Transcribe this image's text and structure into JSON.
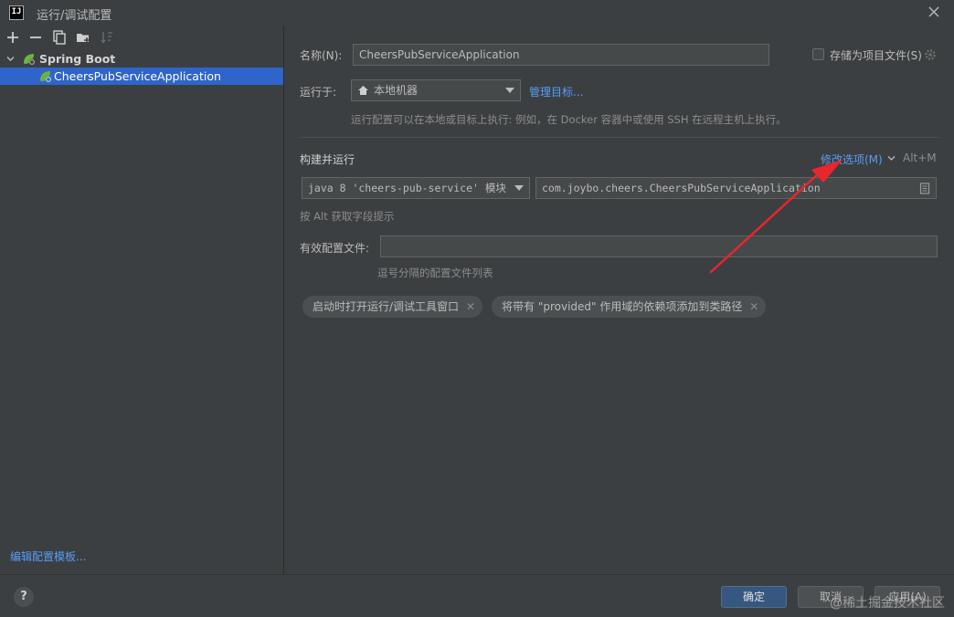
{
  "window": {
    "app_logo": "IJ",
    "title": "运行/调试配置"
  },
  "tree": {
    "group_label": "Spring Boot",
    "selected_item": "CheersPubServiceApplication"
  },
  "left_footer": {
    "edit_templates_link": "编辑配置模板..."
  },
  "form": {
    "name_label": "名称(N):",
    "name_value": "CheersPubServiceApplication",
    "store_as_project_file": "存储为项目文件(S)",
    "run_on_label": "运行于:",
    "run_on_value": "本地机器",
    "manage_targets_link": "管理目标...",
    "run_on_hint": "运行配置可以在本地或目标上执行: 例如，在 Docker 容器中或使用 SSH 在远程主机上执行。",
    "build_run_title": "构建并运行",
    "modify_options_link": "修改选项(M)",
    "modify_options_shortcut": "Alt+M",
    "jdk_value": "java 8 'cheers-pub-service' 模块",
    "main_class_value": "com.joybo.cheers.CheersPubServiceApplication",
    "alt_hint": "按 Alt 获取字段提示",
    "active_profiles_label": "有效配置文件:",
    "active_profiles_value": "",
    "active_profiles_hint": "逗号分隔的配置文件列表",
    "chips": [
      "启动时打开运行/调试工具窗口",
      "将带有 \"provided\" 作用域的依赖项添加到类路径"
    ]
  },
  "buttons": {
    "help": "?",
    "ok": "确定",
    "cancel": "取消",
    "apply": "应用(A)"
  },
  "watermark": "@稀土掘金技术社区",
  "colors": {
    "background": "#3c3f41",
    "selection": "#2f65ca",
    "link": "#589df6",
    "primary_button": "#365880",
    "annotation_arrow": "#e8262c"
  }
}
